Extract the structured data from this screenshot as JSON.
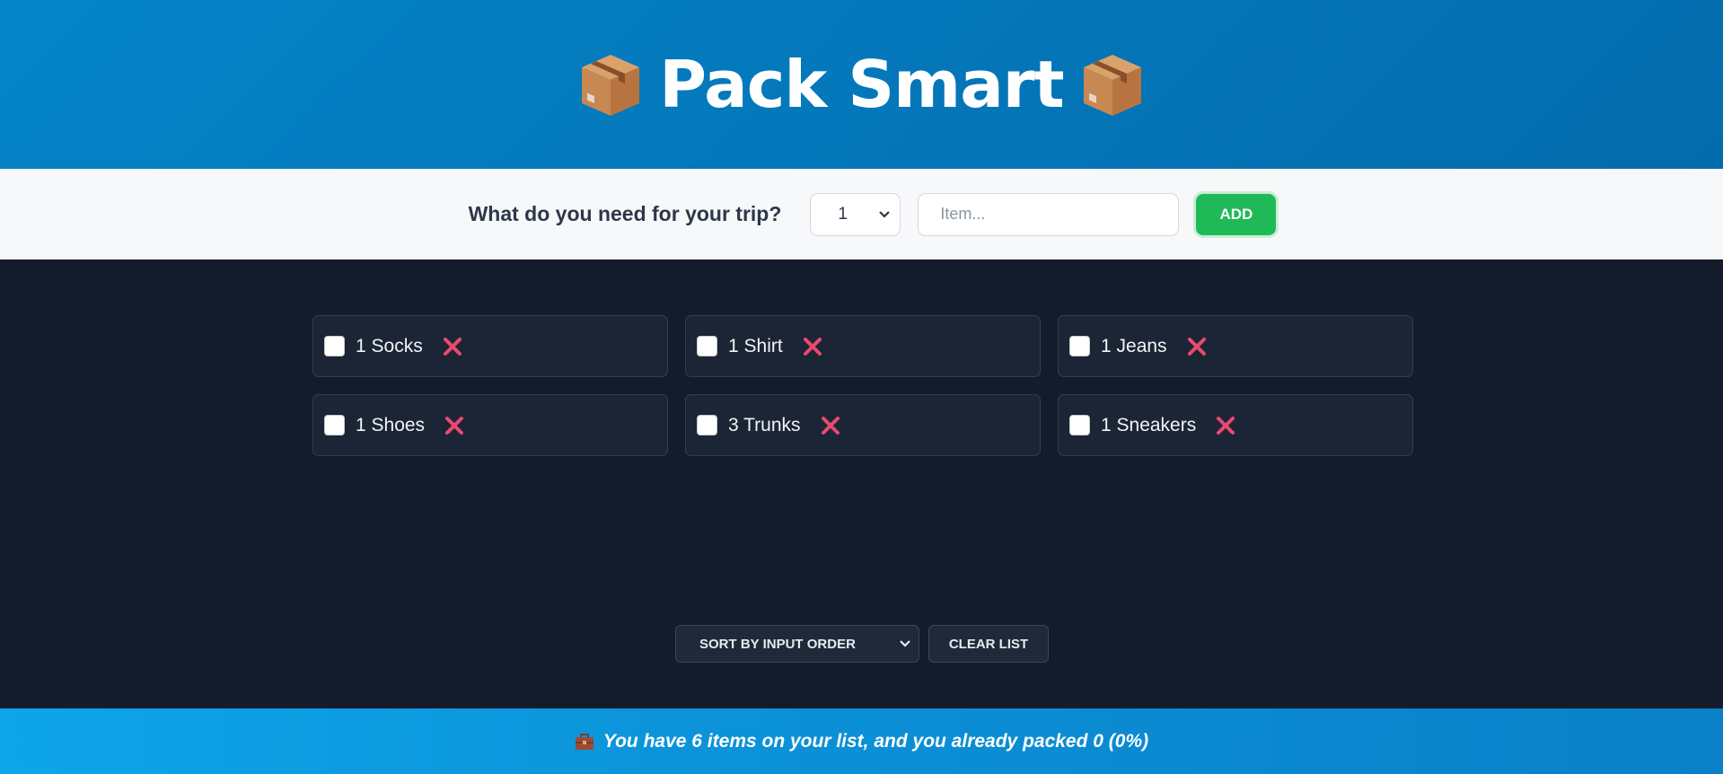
{
  "header": {
    "title": "Pack Smart",
    "icon_left": "package-icon",
    "icon_right": "package-icon"
  },
  "form": {
    "label": "What do you need for your trip?",
    "quantity_value": "1",
    "item_placeholder": "Item...",
    "item_value": "",
    "add_label": "ADD"
  },
  "items": [
    {
      "text": "1 Socks",
      "packed": false
    },
    {
      "text": "1 Shirt",
      "packed": false
    },
    {
      "text": "1 Jeans",
      "packed": false
    },
    {
      "text": "1 Shoes",
      "packed": false
    },
    {
      "text": "3 Trunks",
      "packed": false
    },
    {
      "text": "1 Sneakers",
      "packed": false
    }
  ],
  "controls": {
    "sort_value": "SORT BY INPUT ORDER",
    "clear_label": "CLEAR LIST"
  },
  "footer": {
    "icon": "briefcase-icon",
    "stats_text": "You have 6 items on your list, and you already packed 0 (0%)"
  },
  "colors": {
    "header_bg": "#0484c8",
    "body_bg": "#141b2b",
    "add_button": "#1fba57",
    "delete_icon": "#e84a6f",
    "footer_bg": "#0ea5e9"
  }
}
